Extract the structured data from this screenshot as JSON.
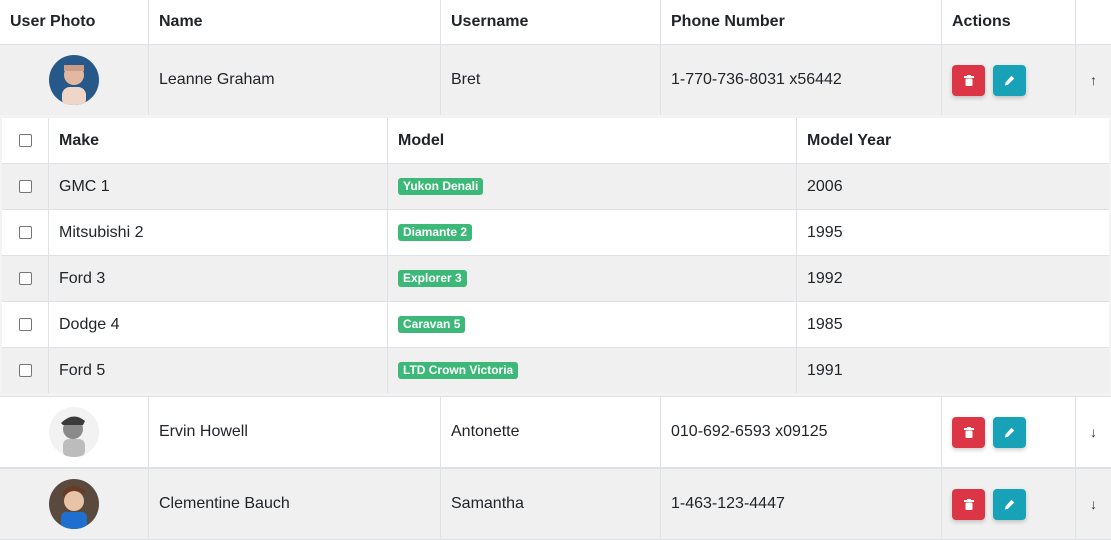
{
  "columns": {
    "photo": "User Photo",
    "name": "Name",
    "username": "Username",
    "phone": "Phone Number",
    "actions": "Actions"
  },
  "users": [
    {
      "name": "Leanne Graham",
      "username": "Bret",
      "phone": "1-770-736-8031 x56442",
      "toggle": "↑"
    },
    {
      "name": "Ervin Howell",
      "username": "Antonette",
      "phone": "010-692-6593 x09125",
      "toggle": "↓"
    },
    {
      "name": "Clementine Bauch",
      "username": "Samantha",
      "phone": "1-463-123-4447",
      "toggle": "↓"
    }
  ],
  "nested": {
    "columns": {
      "make": "Make",
      "model": "Model",
      "year": "Model Year"
    },
    "rows": [
      {
        "make": "GMC 1",
        "model": "Yukon Denali",
        "year": "2006"
      },
      {
        "make": "Mitsubishi 2",
        "model": "Diamante 2",
        "year": "1995"
      },
      {
        "make": "Ford 3",
        "model": "Explorer 3",
        "year": "1992"
      },
      {
        "make": "Dodge 4",
        "model": "Caravan 5",
        "year": "1985"
      },
      {
        "make": "Ford 5",
        "model": "LTD Crown Victoria",
        "year": "1991"
      }
    ]
  },
  "icons": {
    "delete": "trash-icon",
    "edit": "pencil-icon"
  },
  "colors": {
    "delete": "#dc3545",
    "edit": "#17a2b8",
    "badge": "#3cb878"
  }
}
